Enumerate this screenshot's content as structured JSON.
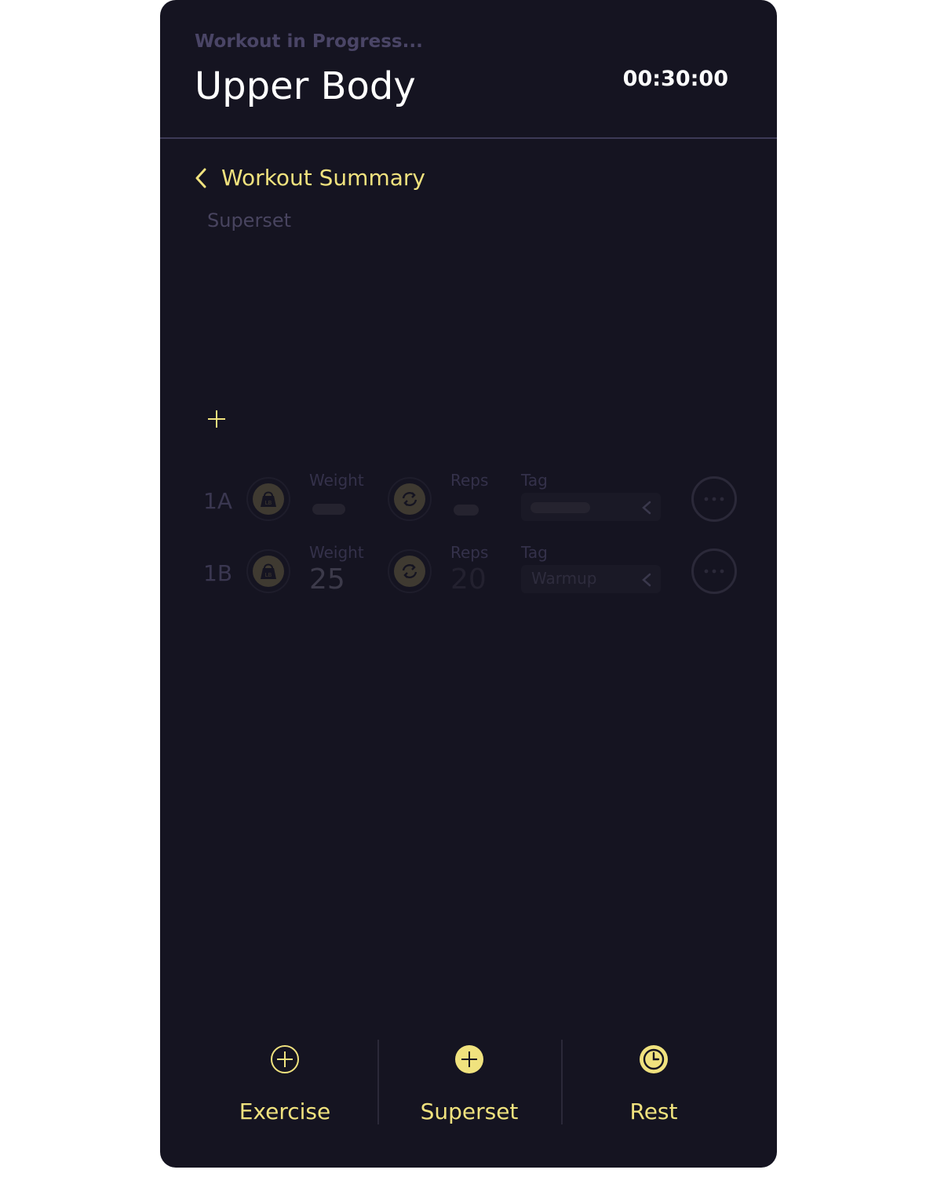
{
  "colors": {
    "background": "#151421",
    "accent": "#f0e27e",
    "muted": "#4a4566",
    "divider": "#3d3a56"
  },
  "header": {
    "status": "Workout in Progress...",
    "title": "Upper Body",
    "timer": "00:30:00"
  },
  "nav": {
    "back_label": "Workout Summary",
    "back_icon": "chevron-left-icon"
  },
  "section": {
    "label": "Superset",
    "add_icon": "plus-icon"
  },
  "sets": [
    {
      "id": "1A",
      "weight_label": "Weight",
      "weight_value": "",
      "reps_label": "Reps",
      "reps_value": "",
      "tag_label": "Tag",
      "tag_value": ""
    },
    {
      "id": "1B",
      "weight_label": "Weight",
      "weight_value": "25",
      "reps_label": "Reps",
      "reps_value": "20",
      "tag_label": "Tag",
      "tag_value": "Warmup"
    }
  ],
  "weight_icon_text": "LB",
  "bottom_bar": {
    "exercise_label": "Exercise",
    "superset_label": "Superset",
    "rest_label": "Rest"
  }
}
